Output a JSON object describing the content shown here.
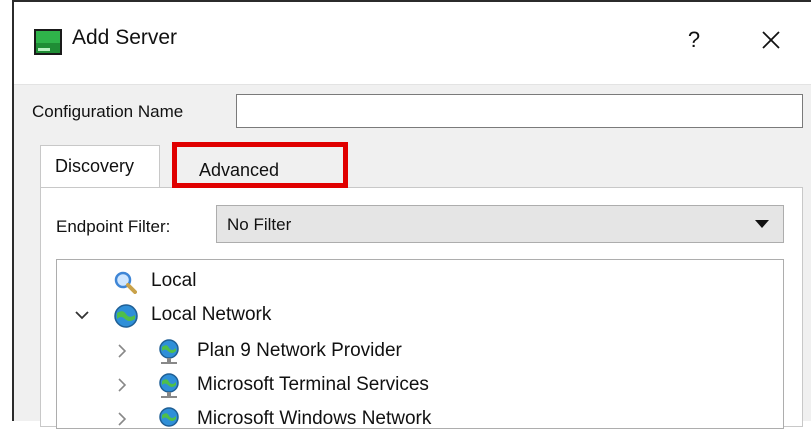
{
  "window": {
    "title": "Add Server",
    "help_glyph": "?",
    "close_icon": "close-icon"
  },
  "config": {
    "label": "Configuration Name",
    "value": ""
  },
  "tabs": [
    {
      "label": "Discovery",
      "selected": true
    },
    {
      "label": "Advanced",
      "selected": false,
      "highlighted": true
    }
  ],
  "filter": {
    "label": "Endpoint Filter:",
    "value": "No Filter"
  },
  "tree": {
    "items": [
      {
        "label": "Local",
        "icon": "search-icon",
        "expander": "none"
      },
      {
        "label": "Local Network",
        "icon": "network-globe-icon",
        "expander": "expanded"
      },
      {
        "label": "Plan 9 Network Provider",
        "icon": "network-provider-icon",
        "expander": "collapsed"
      },
      {
        "label": "Microsoft Terminal Services",
        "icon": "network-provider-icon",
        "expander": "collapsed"
      },
      {
        "label": "Microsoft Windows Network",
        "icon": "network-provider-icon",
        "expander": "collapsed"
      }
    ]
  },
  "colors": {
    "highlight": "#e00000",
    "dialog_bg": "#f0f0f0"
  }
}
